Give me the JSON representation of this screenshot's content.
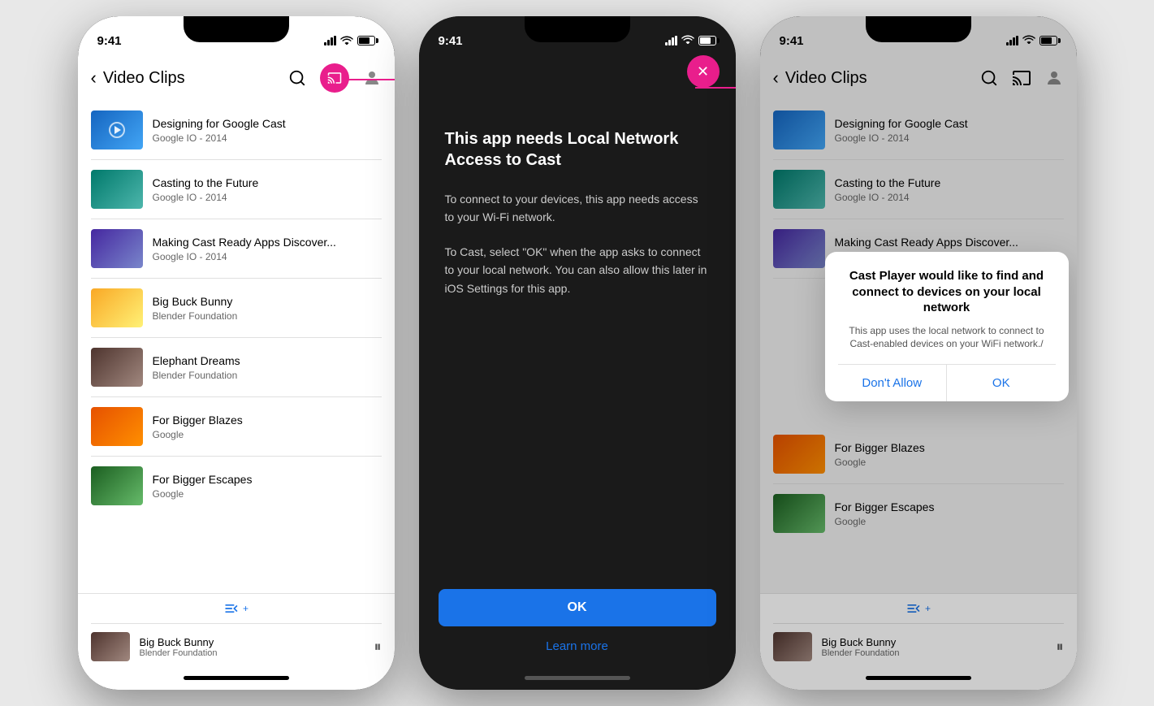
{
  "phones": {
    "left": {
      "status": {
        "time": "9:41"
      },
      "appBar": {
        "title": "Video Clips",
        "backLabel": "‹"
      },
      "videos": [
        {
          "id": 1,
          "title": "Designing for Google Cast",
          "subtitle": "Google IO - 2014",
          "thumbClass": "thumb-google-cast"
        },
        {
          "id": 2,
          "title": "Casting to the Future",
          "subtitle": "Google IO - 2014",
          "thumbClass": "thumb-casting"
        },
        {
          "id": 3,
          "title": "Making Cast Ready Apps Discover...",
          "subtitle": "Google IO - 2014",
          "thumbClass": "thumb-cast-ready"
        },
        {
          "id": 4,
          "title": "Big Buck Bunny",
          "subtitle": "Blender Foundation",
          "thumbClass": "thumb-buck-bunny"
        },
        {
          "id": 5,
          "title": "Elephant Dreams",
          "subtitle": "Blender Foundation",
          "thumbClass": "thumb-elephant"
        },
        {
          "id": 6,
          "title": "For Bigger Blazes",
          "subtitle": "Google",
          "thumbClass": "thumb-bigger-blazes"
        },
        {
          "id": 7,
          "title": "For Bigger Escapes",
          "subtitle": "Google",
          "thumbClass": "thumb-bigger-escapes"
        }
      ],
      "miniPlayer": {
        "title": "Big Buck Bunny",
        "subtitle": "Blender Foundation",
        "thumbClass": "thumb-mini"
      }
    },
    "middle": {
      "status": {
        "time": "9:41"
      },
      "dialog": {
        "title": "This app needs Local Network Access to Cast",
        "body1": "To connect to your devices, this app needs access to your Wi-Fi network.",
        "body2": "To Cast, select \"OK\" when the app asks to connect to your local network. You can also allow this later in iOS Settings for this app.",
        "okLabel": "OK",
        "learnMoreLabel": "Learn more"
      }
    },
    "right": {
      "status": {
        "time": "9:41"
      },
      "appBar": {
        "title": "Video Clips",
        "backLabel": "‹"
      },
      "videos": [
        {
          "id": 1,
          "title": "Designing for Google Cast",
          "subtitle": "Google IO - 2014",
          "thumbClass": "thumb-google-cast"
        },
        {
          "id": 2,
          "title": "Casting to the Future",
          "subtitle": "Google IO - 2014",
          "thumbClass": "thumb-casting"
        },
        {
          "id": 3,
          "title": "Making Cast Ready Apps Discover...",
          "subtitle": "Google IO - 2014",
          "thumbClass": "thumb-cast-ready"
        },
        {
          "id": 4,
          "title": "For Bigger Blazes",
          "subtitle": "Google",
          "thumbClass": "thumb-bigger-blazes"
        },
        {
          "id": 5,
          "title": "For Bigger Escapes",
          "subtitle": "Google",
          "thumbClass": "thumb-bigger-escapes"
        }
      ],
      "miniPlayer": {
        "title": "Big Buck Bunny",
        "subtitle": "Blender Foundation",
        "thumbClass": "thumb-mini"
      },
      "permDialog": {
        "title": "Cast Player would like to find and connect to devices on your local network",
        "body": "This app uses the local network to connect to Cast-enabled devices on your WiFi network./",
        "dontAllowLabel": "Don't Allow",
        "okLabel": "OK"
      }
    }
  },
  "colors": {
    "accent": "#1a73e8",
    "pink": "#e91e8c",
    "darkBg": "#1a1a1a"
  }
}
